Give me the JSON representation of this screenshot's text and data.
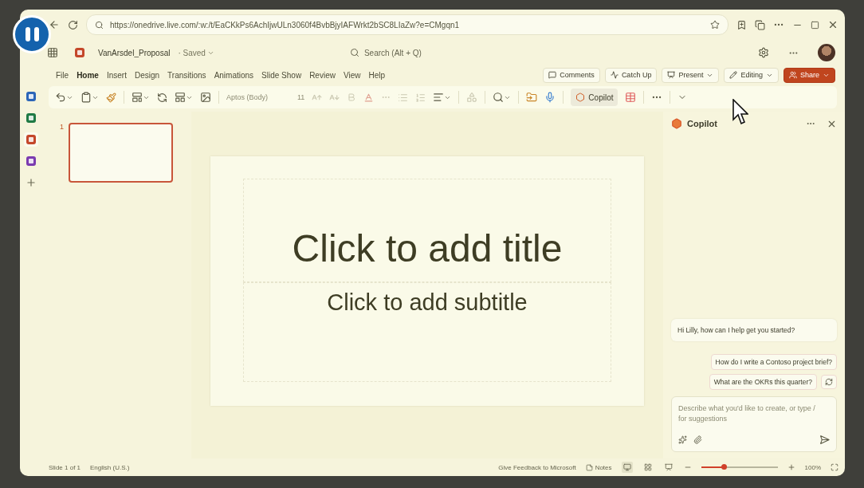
{
  "browser": {
    "url": "https://onedrive.live.com/:w:/t/EaCKkPs6AchIjwULn3060f4BvbBjyIAFWrkt2bSC8LIaZw?e=CMgqn1"
  },
  "app": {
    "file_name": "VanArsdel_Proposal",
    "save_status": "· Saved",
    "search_placeholder": "Search (Alt + Q)"
  },
  "rail": [
    {
      "kind": "word",
      "selected": false
    },
    {
      "kind": "excel",
      "selected": false
    },
    {
      "kind": "powerpoint",
      "selected": true
    },
    {
      "kind": "onenote",
      "selected": false
    },
    {
      "kind": "add",
      "selected": false
    }
  ],
  "tabs": [
    {
      "label": "File",
      "selected": false
    },
    {
      "label": "Home",
      "selected": true
    },
    {
      "label": "Insert",
      "selected": false
    },
    {
      "label": "Design",
      "selected": false
    },
    {
      "label": "Transitions",
      "selected": false
    },
    {
      "label": "Animations",
      "selected": false
    },
    {
      "label": "Slide Show",
      "selected": false
    },
    {
      "label": "Review",
      "selected": false
    },
    {
      "label": "View",
      "selected": false
    },
    {
      "label": "Help",
      "selected": false
    }
  ],
  "actions": [
    {
      "kind": "comments",
      "label": "Comments"
    },
    {
      "kind": "catchup",
      "label": "Catch Up"
    },
    {
      "kind": "present",
      "label": "Present"
    },
    {
      "kind": "editing",
      "label": "Editing"
    },
    {
      "kind": "share",
      "label": "Share"
    }
  ],
  "toolbar": {
    "font": "Aptos (Body)",
    "font_size": "11",
    "copilot_label": "Copilot",
    "copilot_selected": true
  },
  "slides": [
    {
      "number": "1",
      "selected": true
    }
  ],
  "slide": {
    "title": "Click to add title",
    "subtitle": "Click to add subtitle"
  },
  "copilot": {
    "title": "Copilot",
    "greeting": "Hi Lilly, how can I help get you started?",
    "suggestions": [
      "How do I write a Contoso project brief?",
      "What are the OKRs this quarter?"
    ],
    "placeholder": "Describe what you'd like to create, or type / for suggestions"
  },
  "status_bar": {
    "slide_info": "Slide 1 of 1",
    "language": "English (U.S.)",
    "feedback": "Give Feedback to Microsoft",
    "notes": "Notes",
    "views": [
      {
        "kind": "normal",
        "selected": true
      },
      {
        "kind": "sorter",
        "selected": false
      },
      {
        "kind": "reading",
        "selected": false
      }
    ],
    "zoom_slider": {
      "level": 0.3
    },
    "zoom": "100%"
  }
}
